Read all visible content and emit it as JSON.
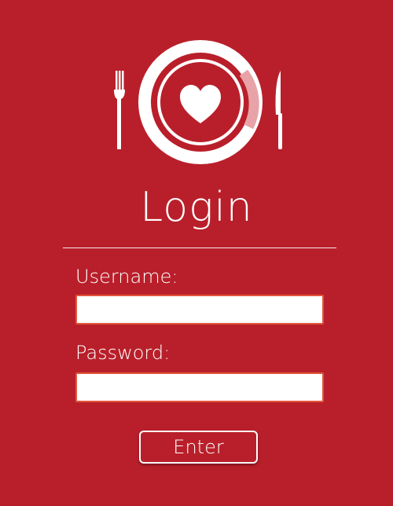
{
  "logo": {
    "icons": [
      "fork-icon",
      "plate-icon",
      "heart-icon",
      "knife-icon"
    ],
    "colors": {
      "background": "#b91f2a",
      "foreground": "#ffffff",
      "plate_progress": "#e8a3a8"
    }
  },
  "form": {
    "title": "Login",
    "username": {
      "label": "Username:",
      "value": "",
      "placeholder": ""
    },
    "password": {
      "label": "Password:",
      "value": "",
      "placeholder": ""
    },
    "enter_label": "Enter"
  },
  "colors": {
    "background": "#b91f2a",
    "input_border": "#e2553b",
    "text": "#ffffff"
  }
}
